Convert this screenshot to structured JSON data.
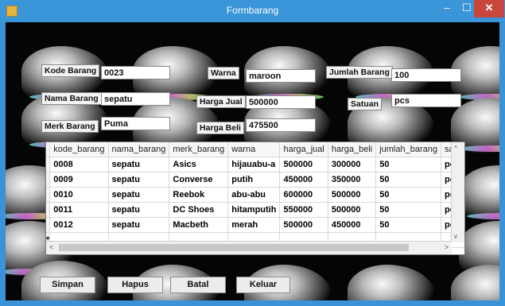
{
  "window": {
    "title": "Formbarang",
    "min": "–",
    "max": "☐",
    "close": "✕"
  },
  "form": {
    "kode_barang_label": "Kode Barang",
    "kode_barang_value": "0023",
    "nama_barang_label": "Nama Barang",
    "nama_barang_value": "sepatu",
    "merk_barang_label": "Merk Barang",
    "merk_barang_value": "Puma",
    "warna_label": "Warna",
    "warna_value": "maroon",
    "harga_jual_label": "Harga Jual",
    "harga_jual_value": "500000",
    "harga_beli_label": "Harga Beli",
    "harga_beli_value": "475500",
    "jumlah_barang_label": "Jumlah Barang",
    "jumlah_barang_value": "100",
    "satuan_label": "Satuan",
    "satuan_value": "pcs"
  },
  "grid": {
    "columns": [
      "kode_barang",
      "nama_barang",
      "merk_barang",
      "warna",
      "harga_jual",
      "harga_beli",
      "jumlah_barang",
      "satu"
    ],
    "rows": [
      [
        "0008",
        "sepatu",
        "Asics",
        "hijauabu-a",
        "500000",
        "300000",
        "50",
        "pcs"
      ],
      [
        "0009",
        "sepatu",
        "Converse",
        "putih",
        "450000",
        "350000",
        "50",
        "pcs"
      ],
      [
        "0010",
        "sepatu",
        "Reebok",
        "abu-abu",
        "600000",
        "500000",
        "50",
        "pcs"
      ],
      [
        "0011",
        "sepatu",
        "DC Shoes",
        "hitamputih",
        "550000",
        "500000",
        "50",
        "pcs"
      ],
      [
        "0012",
        "sepatu",
        "Macbeth",
        "merah",
        "500000",
        "450000",
        "50",
        "pcs"
      ]
    ],
    "new_row_marker": "*",
    "scroll_up": "^",
    "scroll_down": "v",
    "scroll_left": "<",
    "scroll_right": ">"
  },
  "buttons": {
    "simpan": "Simpan",
    "hapus": "Hapus",
    "batal": "Batal",
    "keluar": "Keluar"
  }
}
